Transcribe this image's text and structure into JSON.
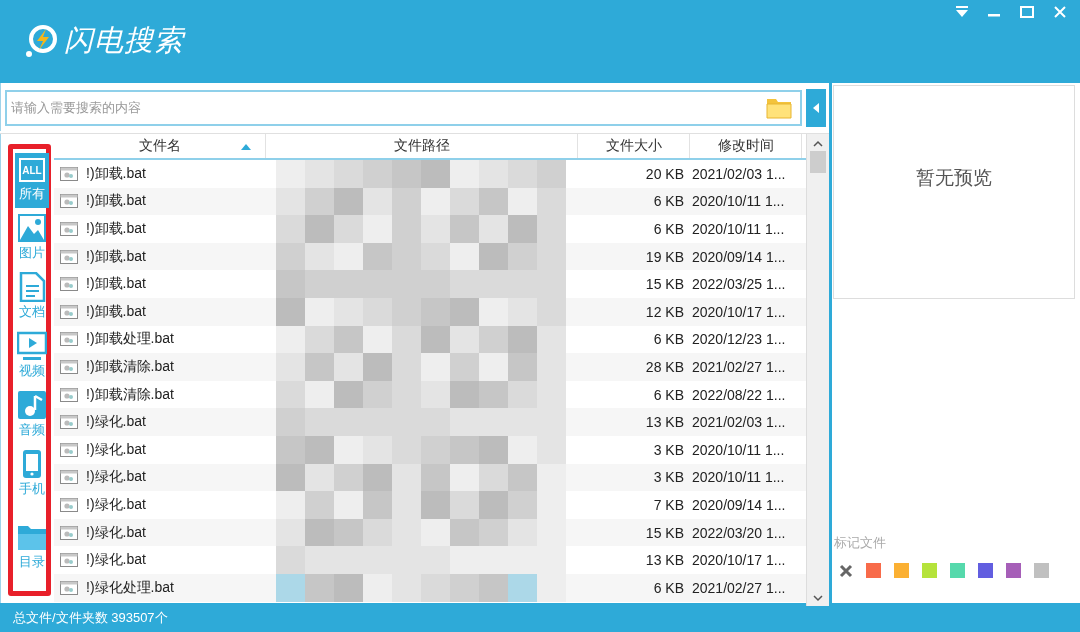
{
  "window": {
    "title": "闪电搜索"
  },
  "search": {
    "placeholder": "请输入需要搜索的内容"
  },
  "sidebar": {
    "highlighted": true,
    "items": [
      {
        "kind": "all",
        "icon_text": "ALL",
        "label": "所有",
        "selected": true
      },
      {
        "kind": "image",
        "label": "图片",
        "selected": false
      },
      {
        "kind": "document",
        "label": "文档",
        "selected": false
      },
      {
        "kind": "video",
        "label": "视频",
        "selected": false
      },
      {
        "kind": "audio",
        "label": "音频",
        "selected": false
      },
      {
        "kind": "phone",
        "label": "手机",
        "selected": false
      },
      {
        "kind": "folder",
        "label": "目录",
        "selected": false
      }
    ]
  },
  "table": {
    "columns": [
      {
        "label": "文件名",
        "sorted": true
      },
      {
        "label": "文件路径",
        "sorted": false
      },
      {
        "label": "文件大小",
        "sorted": false
      },
      {
        "label": "修改时间",
        "sorted": false
      }
    ],
    "rows": [
      {
        "name": "!)卸载.bat",
        "size": "20 KB",
        "modified": "2021/02/03 1..."
      },
      {
        "name": "!)卸载.bat",
        "size": "6 KB",
        "modified": "2020/10/11 1..."
      },
      {
        "name": "!)卸载.bat",
        "size": "6 KB",
        "modified": "2020/10/11 1..."
      },
      {
        "name": "!)卸载.bat",
        "size": "19 KB",
        "modified": "2020/09/14 1..."
      },
      {
        "name": "!)卸载.bat",
        "size": "15 KB",
        "modified": "2022/03/25 1..."
      },
      {
        "name": "!)卸载.bat",
        "size": "12 KB",
        "modified": "2020/10/17 1..."
      },
      {
        "name": "!)卸载处理.bat",
        "size": "6 KB",
        "modified": "2020/12/23 1..."
      },
      {
        "name": "!)卸载清除.bat",
        "size": "28 KB",
        "modified": "2021/02/27 1..."
      },
      {
        "name": "!)卸载清除.bat",
        "size": "6 KB",
        "modified": "2022/08/22 1..."
      },
      {
        "name": "!)绿化.bat",
        "size": "13 KB",
        "modified": "2021/02/03 1..."
      },
      {
        "name": "!)绿化.bat",
        "size": "3 KB",
        "modified": "2020/10/11 1..."
      },
      {
        "name": "!)绿化.bat",
        "size": "3 KB",
        "modified": "2020/10/11 1..."
      },
      {
        "name": "!)绿化.bat",
        "size": "7 KB",
        "modified": "2020/09/14 1..."
      },
      {
        "name": "!)绿化.bat",
        "size": "15 KB",
        "modified": "2022/03/20 1..."
      },
      {
        "name": "!)绿化.bat",
        "size": "13 KB",
        "modified": "2020/10/17 1..."
      },
      {
        "name": "!)绿化处理.bat",
        "size": "6 KB",
        "modified": "2021/02/27 1..."
      }
    ]
  },
  "preview": {
    "text": "暂无预览"
  },
  "tags": {
    "label": "标记文件",
    "colors": [
      {
        "color": "#f86b4a"
      },
      {
        "color": "#fbb033"
      },
      {
        "color": "#b5e33b"
      },
      {
        "color": "#56d9ac"
      },
      {
        "color": "#625ee0"
      },
      {
        "color": "#a65fb8"
      },
      {
        "color": "#c0c0c0"
      }
    ]
  },
  "status_bar": {
    "text": "总文件/文件夹数 393507个"
  }
}
